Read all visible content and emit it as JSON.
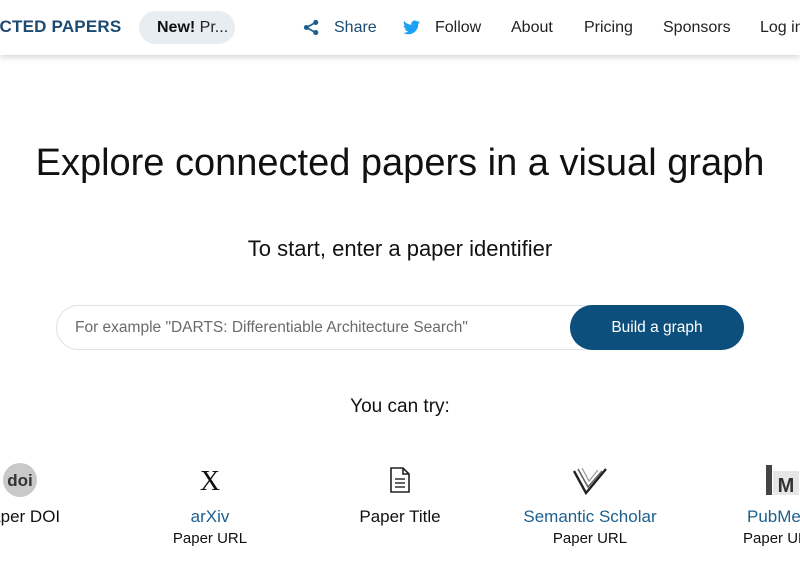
{
  "navbar": {
    "logo_text": "ECTED PAPERS",
    "news_badge": "New!",
    "news_text": " Pr...",
    "share_label": "Share",
    "follow_label": "Follow",
    "about_label": "About",
    "pricing_label": "Pricing",
    "sponsors_label": "Sponsors",
    "login_label": "Log in",
    "icons": {
      "share": "share-icon",
      "follow": "twitter-bird-icon"
    }
  },
  "hero": {
    "title": "Explore connected papers in a visual graph",
    "subtitle": "To start, enter a paper identifier"
  },
  "search": {
    "value": "",
    "placeholder": "For example \"DARTS: Differentiable Architecture Search\"",
    "button_label": "Build a graph"
  },
  "try": {
    "label": "You can try:",
    "items": [
      {
        "name": "Paper DOI",
        "sub": "",
        "icon": "doi-icon"
      },
      {
        "name": "arXiv",
        "sub": "Paper URL",
        "icon": "arxiv-x-icon"
      },
      {
        "name": "Paper Title",
        "sub": "",
        "icon": "document-icon"
      },
      {
        "name": "Semantic Scholar",
        "sub": "Paper URL",
        "icon": "semantic-scholar-icon"
      },
      {
        "name": "PubMed",
        "sub": "Paper URL",
        "icon": "pubmed-icon"
      }
    ]
  },
  "colors": {
    "brand": "#1d4a72",
    "button": "#0d4f7c",
    "link": "#1d5f8e",
    "pill_bg": "#e8edf2"
  }
}
